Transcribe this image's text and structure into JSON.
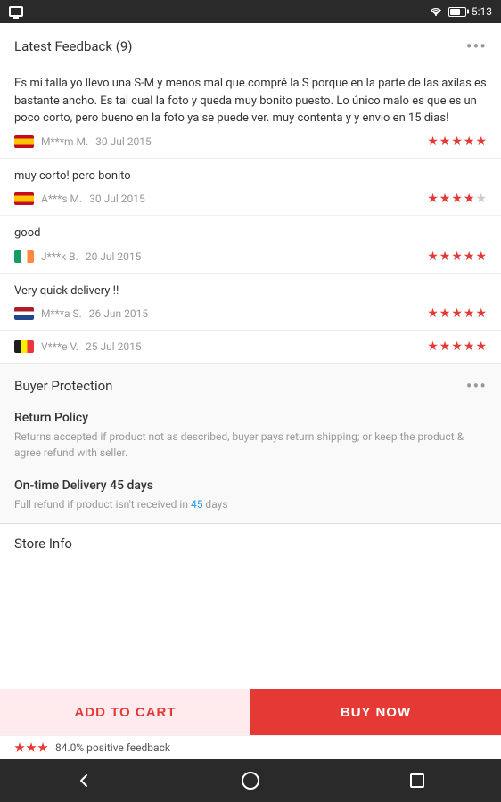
{
  "statusBar": {
    "time": "5:13"
  },
  "feedbackSection": {
    "title": "Latest Feedback (9)",
    "moreLabel": "•••"
  },
  "reviews": [
    {
      "text": "Es mi talla yo llevo una S-M y menos mal que compré la S porque en la parte de las axilas es bastante ancho. Es tal cual la foto y queda muy bonito puesto. Lo único malo es que es un poco corto, pero bueno en la foto ya se puede ver. muy contenta y y envio en 15 dias!",
      "flag": "spain",
      "reviewer": "M***m M.",
      "date": "30 Jul 2015",
      "stars": 5,
      "maxStars": 5
    },
    {
      "text": "muy corto! pero bonito",
      "flag": "spain",
      "reviewer": "A***s M.",
      "date": "30 Jul 2015",
      "stars": 4,
      "maxStars": 5
    },
    {
      "text": "good",
      "flag": "ireland",
      "reviewer": "J***k B.",
      "date": "20 Jul 2015",
      "stars": 5,
      "maxStars": 5
    },
    {
      "text": "Very quick delivery !!",
      "flag": "netherlands",
      "reviewer": "M***a S.",
      "date": "26 Jun 2015",
      "stars": 5,
      "maxStars": 5
    },
    {
      "text": "",
      "flag": "belgium",
      "reviewer": "V***e V.",
      "date": "25 Jul 2015",
      "stars": 5,
      "maxStars": 5
    }
  ],
  "buyerProtection": {
    "title": "Buyer Protection",
    "moreLabel": "•••",
    "returnPolicy": {
      "title": "Return Policy",
      "description": "Returns accepted if product not as described, buyer pays return shipping; or keep the product & agree refund with seller."
    },
    "onTimeDelivery": {
      "title": "On-time Delivery 45 days",
      "descriptionBefore": "Full refund if product isn't received in ",
      "highlightedDays": "45",
      "descriptionAfter": " days"
    }
  },
  "storeInfo": {
    "title": "Store Info",
    "positiveText": "84.0% positive feedback"
  },
  "buttons": {
    "addToCart": "ADD TO CART",
    "buyNow": "BUY NOW"
  },
  "navigation": {
    "back": "back",
    "home": "home",
    "recents": "recents"
  }
}
